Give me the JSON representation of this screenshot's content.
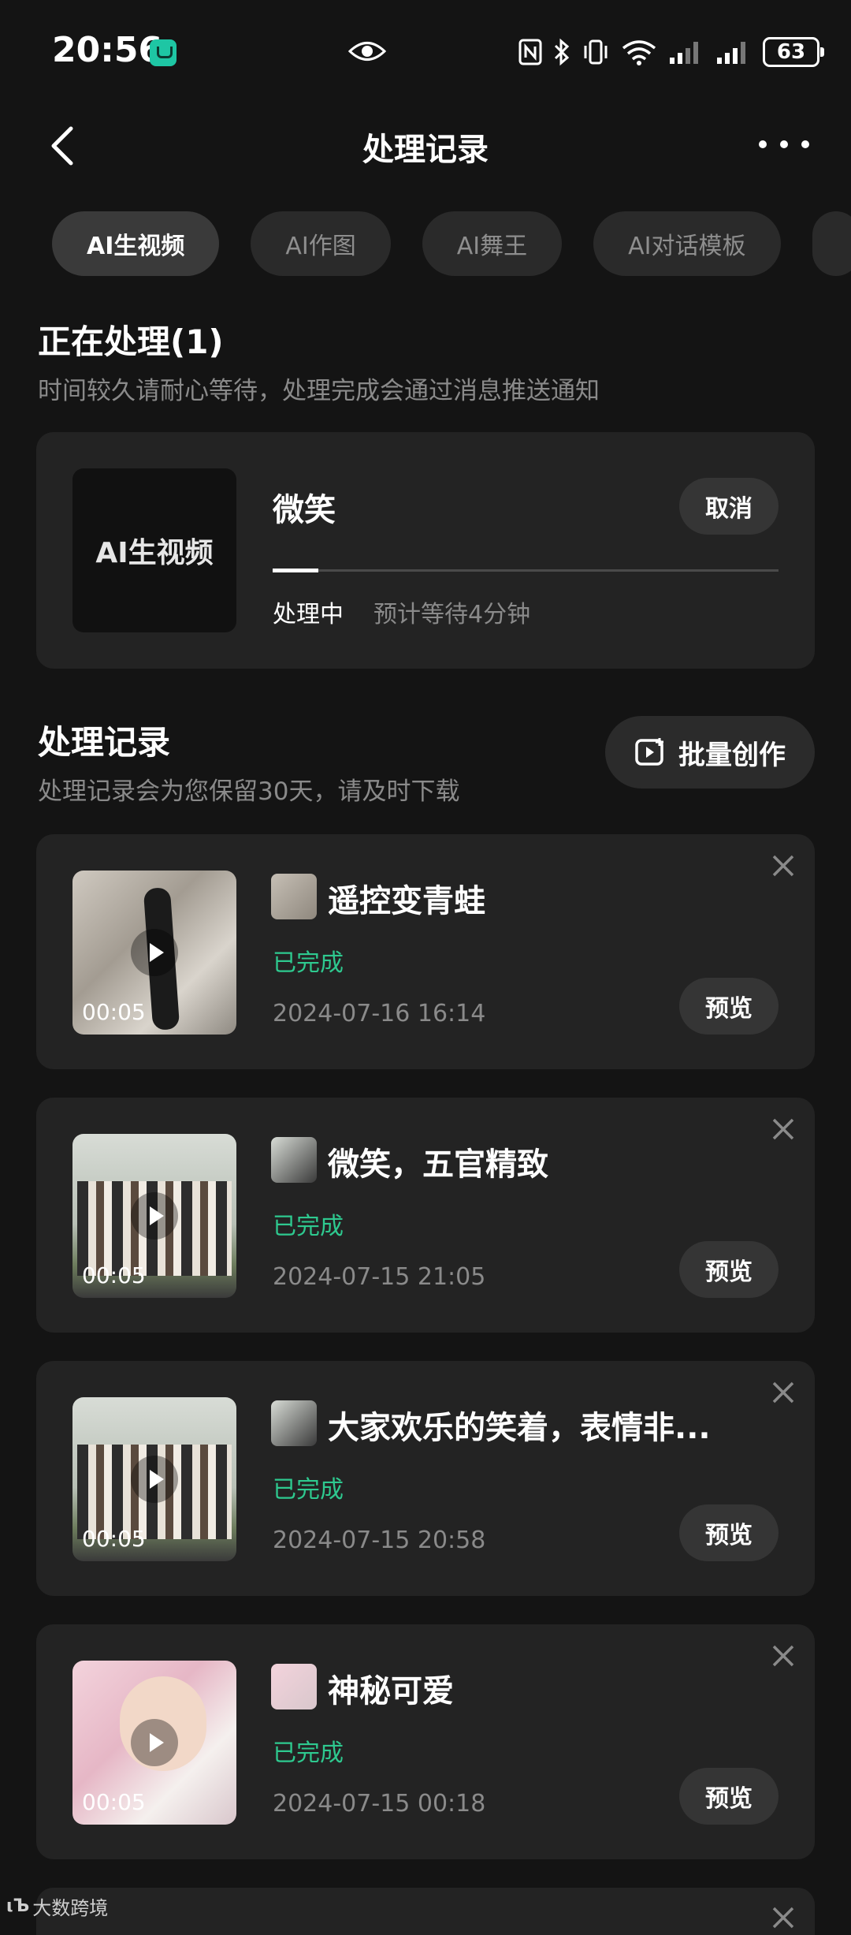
{
  "status_bar": {
    "time": "20:56",
    "battery": "63"
  },
  "header": {
    "title": "处理记录"
  },
  "tabs": [
    {
      "label": "AI生视频",
      "active": true
    },
    {
      "label": "AI作图",
      "active": false
    },
    {
      "label": "AI舞王",
      "active": false
    },
    {
      "label": "AI对话模板",
      "active": false
    }
  ],
  "processing": {
    "title": "正在处理(1)",
    "subtitle": "时间较久请耐心等待，处理完成会通过消息推送通知",
    "item": {
      "thumb_label": "AI生视频",
      "name": "微笑",
      "cancel_label": "取消",
      "status": "处理中",
      "eta": "预计等待4分钟",
      "progress": 0.09
    }
  },
  "records": {
    "title": "处理记录",
    "subtitle": "处理记录会为您保留30天，请及时下载",
    "batch_label": "批量创作",
    "items": [
      {
        "title": "遥控变青蛙",
        "status": "已完成",
        "date": "2024-07-16 16:14",
        "duration": "00:05",
        "preview": "预览"
      },
      {
        "title": "微笑，五官精致",
        "status": "已完成",
        "date": "2024-07-15 21:05",
        "duration": "00:05",
        "preview": "预览"
      },
      {
        "title": "大家欢乐的笑着，表情非...",
        "status": "已完成",
        "date": "2024-07-15 20:58",
        "duration": "00:05",
        "preview": "预览"
      },
      {
        "title": "神秘可爱",
        "status": "已完成",
        "date": "2024-07-15 00:18",
        "duration": "00:05",
        "preview": "预览"
      }
    ]
  },
  "watermark": {
    "text": "大数跨境"
  },
  "colors": {
    "background": "#141414",
    "card": "#232323",
    "done": "#2ec98f",
    "accent_mi": "#1ec6a4"
  }
}
